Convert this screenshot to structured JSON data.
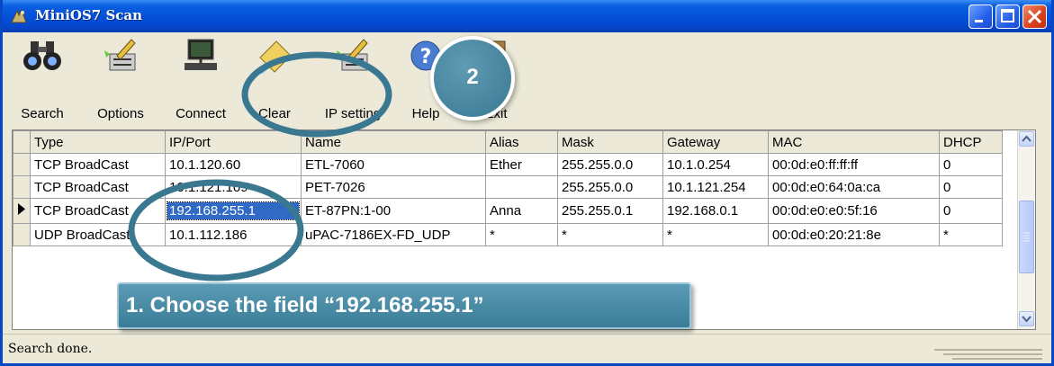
{
  "window": {
    "title": "MiniOS7 Scan",
    "status": "Search done."
  },
  "toolbar": {
    "search": "Search",
    "options": "Options",
    "connect": "Connect",
    "clear": "Clear",
    "ip_setting": "IP setting",
    "help": "Help",
    "exit": "Exit"
  },
  "table": {
    "columns": [
      "Type",
      "IP/Port",
      "Name",
      "Alias",
      "Mask",
      "Gateway",
      "MAC",
      "DHCP"
    ],
    "rows": [
      [
        "TCP BroadCast",
        "10.1.120.60",
        "ETL-7060",
        "Ether",
        "255.255.0.0",
        "10.1.0.254",
        "00:0d:e0:ff:ff:ff",
        "0"
      ],
      [
        "TCP BroadCast",
        "10.1.121.109",
        "PET-7026",
        "",
        "255.255.0.0",
        "10.1.121.254",
        "00:0d:e0:64:0a:ca",
        "0"
      ],
      [
        "TCP BroadCast",
        "192.168.255.1",
        "ET-87PN:1-00",
        "Anna",
        "255.255.0.1",
        "192.168.0.1",
        "00:0d:e0:e0:5f:16",
        "0"
      ],
      [
        "UDP BroadCast",
        "10.1.112.186",
        "uPAC-7186EX-FD_UDP",
        "*",
        "*",
        "*",
        "00:0d:e0:20:21:8e",
        "*"
      ]
    ],
    "selected_row": 2
  },
  "annotations": {
    "step1": "1. Choose the field “192.168.255.1”",
    "step2": "2"
  },
  "colors": {
    "titlebar": "#0551da",
    "selection": "#316ac5",
    "annotation_ring": "#3a7892",
    "callout": "#3b7d98"
  },
  "icons": {
    "search": "binoculars-icon",
    "options": "settings-pen-icon",
    "connect": "computer-connect-icon",
    "clear": "eraser-icon",
    "ip_setting": "settings-pen-icon",
    "help": "help-icon",
    "exit": "exit-icon"
  }
}
